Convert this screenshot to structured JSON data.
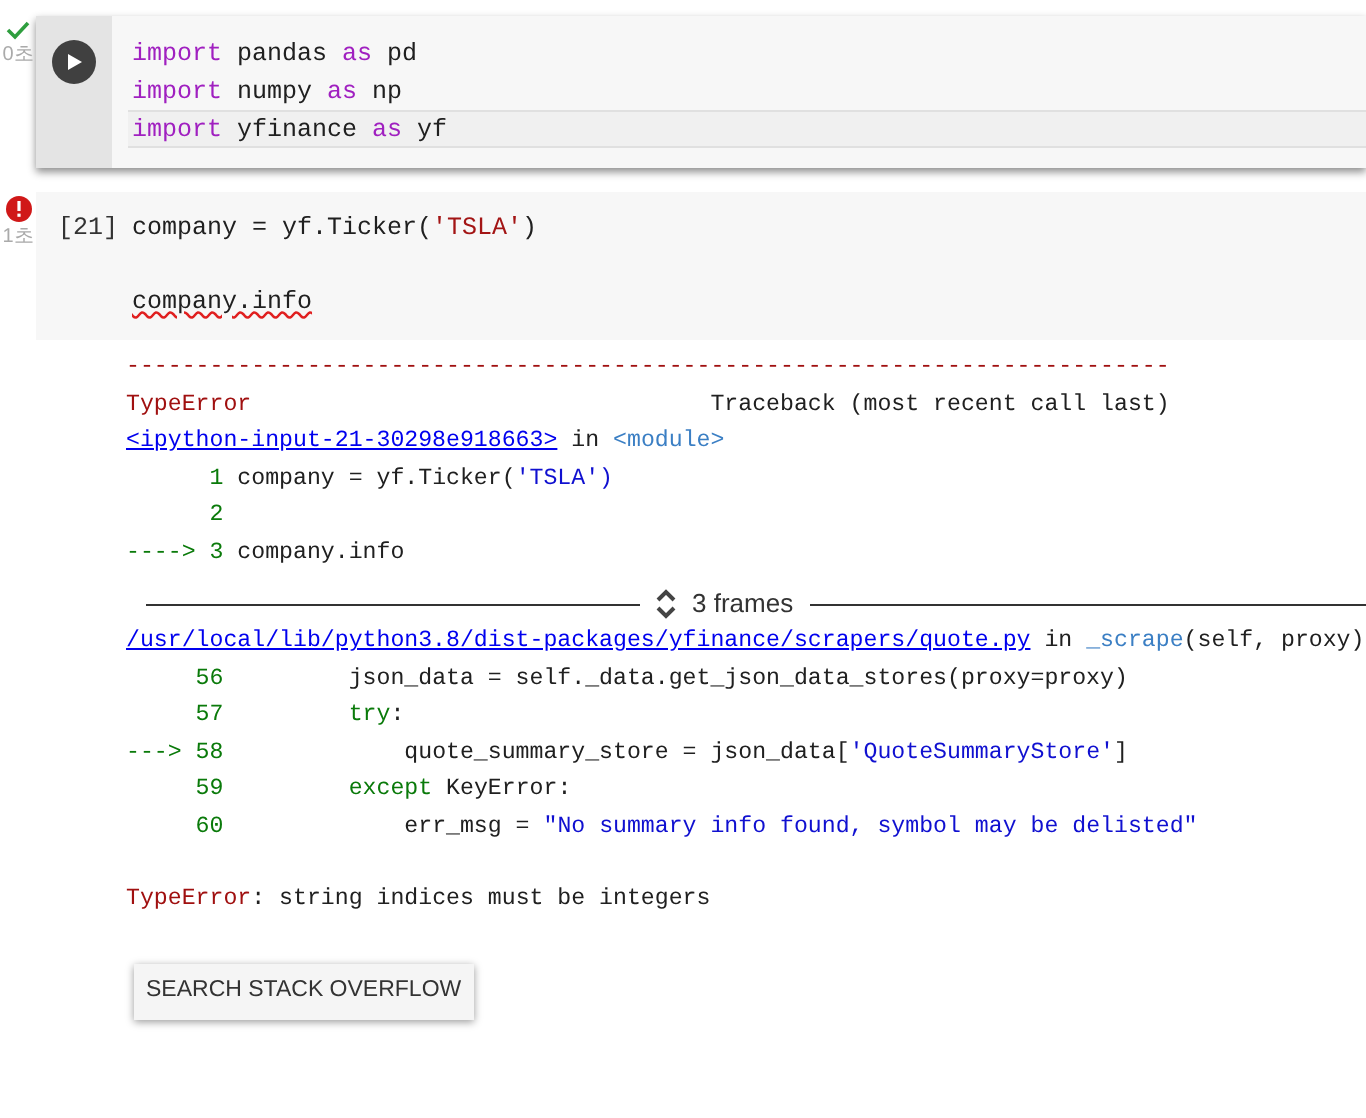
{
  "cells": [
    {
      "kind": "success",
      "exec_time": "0초",
      "focused": true,
      "code": [
        {
          "current": false,
          "tokens": [
            {
              "kind": "kw",
              "t": "import"
            },
            {
              "kind": "plain",
              "t": " pandas "
            },
            {
              "kind": "kw",
              "t": "as"
            },
            {
              "kind": "plain",
              "t": " pd"
            }
          ]
        },
        {
          "current": false,
          "tokens": [
            {
              "kind": "kw",
              "t": "import"
            },
            {
              "kind": "plain",
              "t": " numpy "
            },
            {
              "kind": "kw",
              "t": "as"
            },
            {
              "kind": "plain",
              "t": " np"
            }
          ]
        },
        {
          "current": true,
          "tokens": [
            {
              "kind": "kw",
              "t": "import"
            },
            {
              "kind": "plain",
              "t": " yfinance "
            },
            {
              "kind": "kw",
              "t": "as"
            },
            {
              "kind": "plain",
              "t": " yf"
            }
          ]
        }
      ]
    },
    {
      "kind": "error",
      "exec_time": "1초",
      "focused": false,
      "exec_count": "[21]",
      "code": [
        {
          "current": false,
          "tokens": [
            {
              "kind": "plain",
              "t": "company = yf.Ticker("
            },
            {
              "kind": "str",
              "t": "'TSLA'"
            },
            {
              "kind": "plain",
              "t": ")"
            }
          ]
        },
        {
          "current": false,
          "gap_before": true,
          "tokens": [
            {
              "kind": "misspelled",
              "t": "company.info"
            }
          ]
        }
      ],
      "output": {
        "lines": [
          [
            {
              "kind": "err",
              "t": "---------------------------------------------------------------------------"
            }
          ],
          [
            {
              "kind": "err",
              "t": "TypeError"
            },
            {
              "kind": "plain",
              "t": "                                 Traceback (most recent call last)"
            }
          ],
          [
            {
              "kind": "link",
              "t": "<ipython-input-21-30298e918663>"
            },
            {
              "kind": "plain",
              "t": " in "
            },
            {
              "kind": "func",
              "t": "<module>"
            }
          ],
          [
            {
              "kind": "lineno",
              "t": "      1"
            },
            {
              "kind": "plain",
              "t": " company = yf.Ticker("
            },
            {
              "kind": "str2",
              "t": "'TSLA')"
            }
          ],
          [
            {
              "kind": "lineno",
              "t": "      2"
            }
          ],
          [
            {
              "kind": "lineno",
              "t": "----> 3"
            },
            {
              "kind": "plain",
              "t": " company.info"
            }
          ]
        ],
        "frames_label": "3 frames",
        "frame_lines": [
          [
            {
              "kind": "link",
              "t": "/usr/local/lib/python3.8/dist-packages/yfinance/scrapers/quote.py"
            },
            {
              "kind": "plain",
              "t": " in "
            },
            {
              "kind": "func",
              "t": "_scrape"
            },
            {
              "kind": "plain",
              "t": "(self, proxy)"
            }
          ],
          [
            {
              "kind": "lineno",
              "t": "     56"
            },
            {
              "kind": "plain",
              "t": "         json_data = self._data.get_json_data_stores(proxy=proxy)"
            }
          ],
          [
            {
              "kind": "lineno",
              "t": "     57"
            },
            {
              "kind": "kwg",
              "t": "         try"
            },
            {
              "kind": "plain",
              "t": ":"
            }
          ],
          [
            {
              "kind": "lineno",
              "t": "---> 58"
            },
            {
              "kind": "plain",
              "t": "             quote_summary_store = json_data["
            },
            {
              "kind": "str2",
              "t": "'QuoteSummaryStore'"
            },
            {
              "kind": "plain",
              "t": "]"
            }
          ],
          [
            {
              "kind": "lineno",
              "t": "     59"
            },
            {
              "kind": "kwg",
              "t": "         except"
            },
            {
              "kind": "plain",
              "t": " KeyError:"
            }
          ],
          [
            {
              "kind": "lineno",
              "t": "     60"
            },
            {
              "kind": "plain",
              "t": "             err_msg = "
            },
            {
              "kind": "str2",
              "t": "\"No summary info found, symbol may be delisted\""
            }
          ]
        ],
        "error": [
          {
            "kind": "err",
            "t": "TypeError"
          },
          {
            "kind": "plain",
            "t": ": string indices must be integers"
          }
        ],
        "button": "SEARCH STACK OVERFLOW"
      }
    }
  ]
}
